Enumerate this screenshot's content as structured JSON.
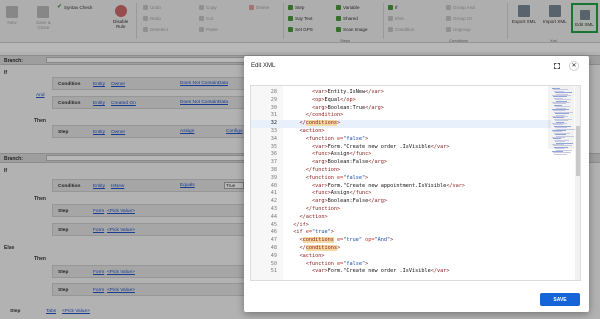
{
  "toolbar": {
    "new": "New",
    "save_close": "Save &\nClose",
    "syntax_check": "Syntax Check",
    "disable_rule": "Disable\nRule",
    "undo": "Undo",
    "redo": "Redo",
    "deselect": "Deselect",
    "copy": "Copy",
    "cut": "Cut",
    "paste": "Paste",
    "delete": "Delete",
    "step": "Step",
    "say_text": "Say Text",
    "set_gps": "Set GPS",
    "variable": "Variable",
    "shared": "Shared",
    "scan_image": "Scan Image",
    "if": "If",
    "else": "Else",
    "condition": "Condition",
    "group_and": "Group And",
    "group_or": "Group Or",
    "ungroup": "Ungroup",
    "export_xml": "Export XML",
    "import_xml": "Import XML",
    "edit_xml": "Edit XML",
    "groups": {
      "steps": "Steps",
      "conditions": "Conditions",
      "xml": "Xml"
    }
  },
  "editor": {
    "branch_label": "Branch:",
    "if": "If",
    "and": "And",
    "then": "Then",
    "else": "Else",
    "condition": "Condition",
    "step": "Step",
    "branch1": {
      "row1": {
        "left": "Entity",
        "right": "Owner",
        "op": "Does Not ContainData"
      },
      "row2": {
        "left": "Entity",
        "right": "Created On",
        "op": "Does Not ContainData"
      },
      "step": {
        "left": "Entity",
        "right": "Owner",
        "action": "Assign",
        "extra": "Configu"
      }
    },
    "branch2": {
      "cond": {
        "left": "Entity",
        "right": "IsNew",
        "op": "Equals",
        "value": "True"
      },
      "step1": {
        "left": "Form",
        "right": "<Pick Value>"
      },
      "step2": {
        "left": "Form",
        "right": "<Pick Value>"
      },
      "else_step1": {
        "left": "Form",
        "right": "<Pick Value>"
      },
      "else_step2": {
        "left": "Form",
        "right": "<Pick Value>"
      }
    },
    "bottom_step": {
      "left": "Tabs",
      "right": "<Pick Value>"
    }
  },
  "modal": {
    "title": "Edit XML",
    "expand_icon": "expand-icon",
    "close_icon": "close-icon",
    "save": "SAVE",
    "highlight_line": 32,
    "lines": [
      {
        "n": "28",
        "html": "        <span class='t'>&lt;var&gt;</span><span class='txt'>Entity.IsNew</span><span class='t'>&lt;/var&gt;</span>"
      },
      {
        "n": "29",
        "html": "        <span class='t'>&lt;op&gt;</span><span class='txt'>Equal</span><span class='t'>&lt;/op&gt;</span>"
      },
      {
        "n": "30",
        "html": "        <span class='t'>&lt;arg&gt;</span><span class='txt'>Boolean:True</span><span class='t'>&lt;/arg&gt;</span>"
      },
      {
        "n": "31",
        "html": "      <span class='t'>&lt;/condition&gt;</span>"
      },
      {
        "n": "32",
        "html": "    <span class='t'>&lt;/<span class='mk'>conditions</span>&gt;</span>"
      },
      {
        "n": "33",
        "html": "    <span class='t'>&lt;action&gt;</span>"
      },
      {
        "n": "34",
        "html": "      <span class='t'>&lt;function</span> <span class='a'>e=</span><span class='v'>\"false\"</span><span class='t'>&gt;</span>"
      },
      {
        "n": "35",
        "html": "        <span class='t'>&lt;var&gt;</span><span class='txt'>Form.\"Create new order .IsVisible</span><span class='t'>&lt;/var&gt;</span>"
      },
      {
        "n": "36",
        "html": "        <span class='t'>&lt;func&gt;</span><span class='txt'>Assign</span><span class='t'>&lt;/func&gt;</span>"
      },
      {
        "n": "37",
        "html": "        <span class='t'>&lt;arg&gt;</span><span class='txt'>Boolean:False</span><span class='t'>&lt;/arg&gt;</span>"
      },
      {
        "n": "38",
        "html": "      <span class='t'>&lt;/function&gt;</span>"
      },
      {
        "n": "39",
        "html": "      <span class='t'>&lt;function</span> <span class='a'>e=</span><span class='v'>\"false\"</span><span class='t'>&gt;</span>"
      },
      {
        "n": "40",
        "html": "        <span class='t'>&lt;var&gt;</span><span class='txt'>Form.\"Create new appointment.IsVisible</span><span class='t'>&lt;/var&gt;</span>"
      },
      {
        "n": "41",
        "html": "        <span class='t'>&lt;func&gt;</span><span class='txt'>Assign</span><span class='t'>&lt;/func&gt;</span>"
      },
      {
        "n": "42",
        "html": "        <span class='t'>&lt;arg&gt;</span><span class='txt'>Boolean:False</span><span class='t'>&lt;/arg&gt;</span>"
      },
      {
        "n": "43",
        "html": "      <span class='t'>&lt;/function&gt;</span>"
      },
      {
        "n": "44",
        "html": "    <span class='t'>&lt;/action&gt;</span>"
      },
      {
        "n": "45",
        "html": "  <span class='t'>&lt;/if&gt;</span>"
      },
      {
        "n": "46",
        "html": "  <span class='t'>&lt;if</span> <span class='a'>e=</span><span class='v'>\"true\"</span><span class='t'>&gt;</span>"
      },
      {
        "n": "47",
        "html": "    <span class='t'>&lt;<span class='mk'>conditions</span></span> <span class='a'>e=</span><span class='v'>\"true\"</span> <span class='a'>op=</span><span class='v'>\"And\"</span><span class='t'>&gt;</span>"
      },
      {
        "n": "48",
        "html": "    <span class='t'>&lt;/<span class='mk'>conditions</span>&gt;</span>"
      },
      {
        "n": "49",
        "html": "    <span class='t'>&lt;action&gt;</span>"
      },
      {
        "n": "50",
        "html": "      <span class='t'>&lt;function</span> <span class='a'>e=</span><span class='v'>\"false\"</span><span class='t'>&gt;</span>"
      },
      {
        "n": "51",
        "html": "        <span class='t'>&lt;var&gt;</span><span class='txt'>Form.\"Create new order .IsVisible</span><span class='t'>&lt;/var&gt;</span>"
      }
    ]
  }
}
